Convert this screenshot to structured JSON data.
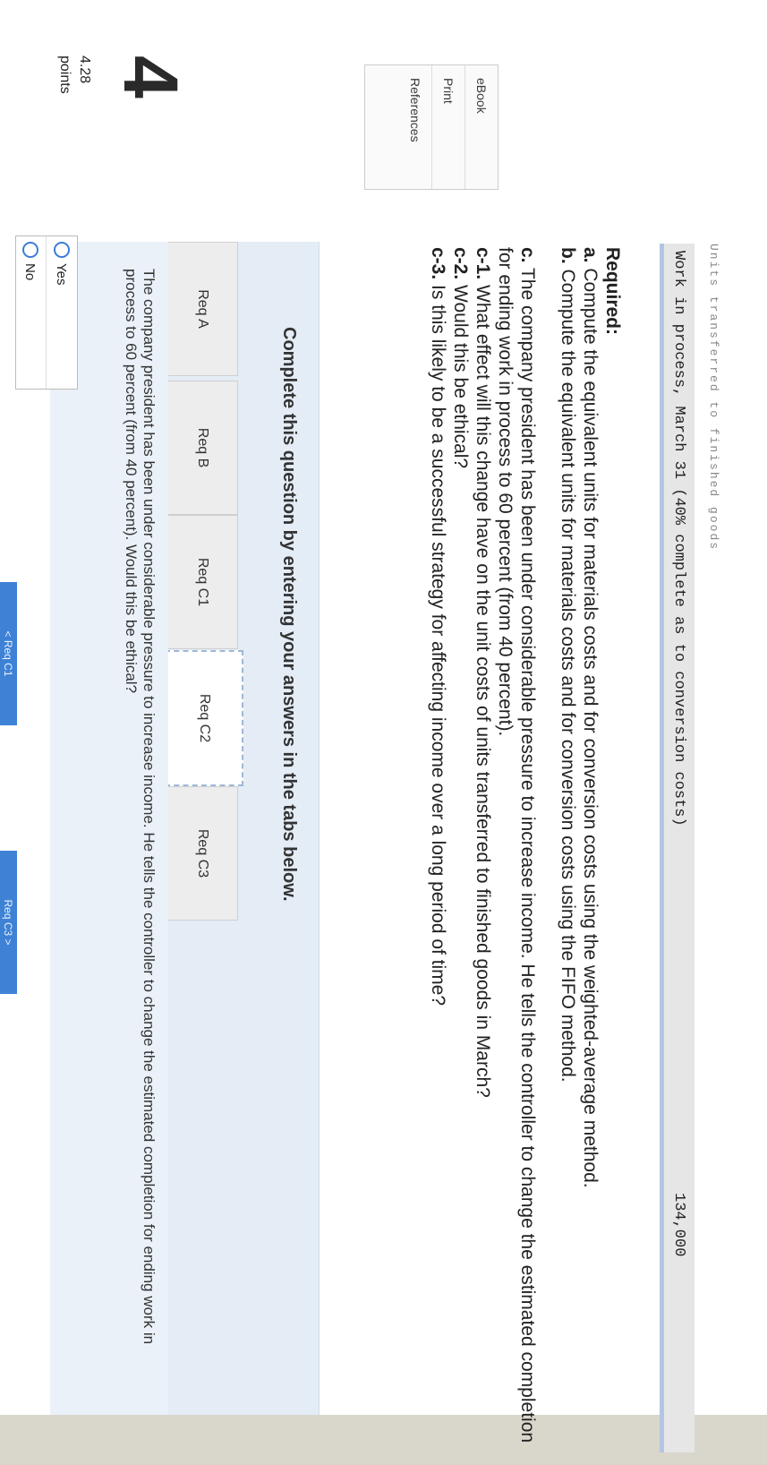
{
  "question": {
    "number": "4",
    "points_value": "4.28",
    "points_label": "points"
  },
  "sidebar": {
    "items": [
      "eBook",
      "Print",
      "References"
    ]
  },
  "problem_row": {
    "truncated_text": "Units transferred to finished goods",
    "label": "Work in process, March 31 (40% complete as to conversion costs)",
    "value": "134,000"
  },
  "required": {
    "heading": "Required:",
    "a": {
      "prefix": "a.",
      "text": " Compute the equivalent units for materials costs and for conversion costs using the weighted-average method."
    },
    "b": {
      "prefix": "b.",
      "text": " Compute the equivalent units for materials costs and for conversion costs using the FIFO method."
    },
    "c": {
      "prefix": "c.",
      "text": " The company president has been under considerable pressure to increase income. He tells the controller to change the estimated completion for ending work in process to 60 percent (from 40 percent)."
    },
    "c1": {
      "prefix": "c-1.",
      "text": " What effect will this change have on the unit costs of units transferred to finished goods in March?"
    },
    "c2": {
      "prefix": "c-2.",
      "text": " Would this be ethical?"
    },
    "c3": {
      "prefix": "c-3.",
      "text": " Is this likely to be a successful strategy for affecting income over a long period of time?"
    }
  },
  "complete_box": {
    "title": "Complete this question by entering your answers in the tabs below.",
    "tabs": [
      "Req A",
      "Req B",
      "Req C1",
      "Req C2",
      "Req C3"
    ],
    "active_tab": "Req C2",
    "content_text": "The company president has been under considerable pressure to increase income. He tells the controller to change the estimated completion for ending work in process to 60 percent (from 40 percent). Would this be ethical?"
  },
  "answer": {
    "options": [
      "Yes",
      "No"
    ],
    "selected": ""
  },
  "nav": {
    "prev": "< Req C1",
    "next": "Req C3 >"
  }
}
